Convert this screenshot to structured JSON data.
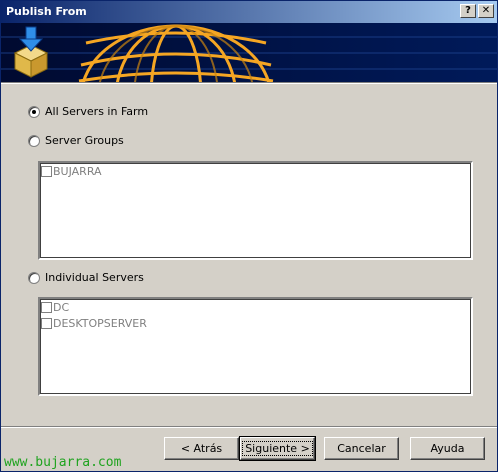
{
  "window": {
    "title": "Publish From",
    "help_glyph": "?",
    "close_glyph": "✕"
  },
  "options": {
    "all_servers": {
      "label": "All Servers in Farm",
      "selected": true
    },
    "server_groups": {
      "label": "Server Groups",
      "selected": false,
      "items": [
        "BUJARRA"
      ]
    },
    "individual_servers": {
      "label": "Individual Servers",
      "selected": false,
      "items": [
        "DC",
        "DESKTOPSERVER"
      ]
    }
  },
  "buttons": {
    "back": "< Atrás",
    "next": "Siguiente >",
    "cancel": "Cancelar",
    "help": "Ayuda"
  },
  "watermark": "www.bujarra.com",
  "colors": {
    "title_start": "#0a246a",
    "title_end": "#a6caf0",
    "banner_bg": "#000e3a",
    "globe": "#f5a623",
    "watermark": "#1fa31f"
  }
}
